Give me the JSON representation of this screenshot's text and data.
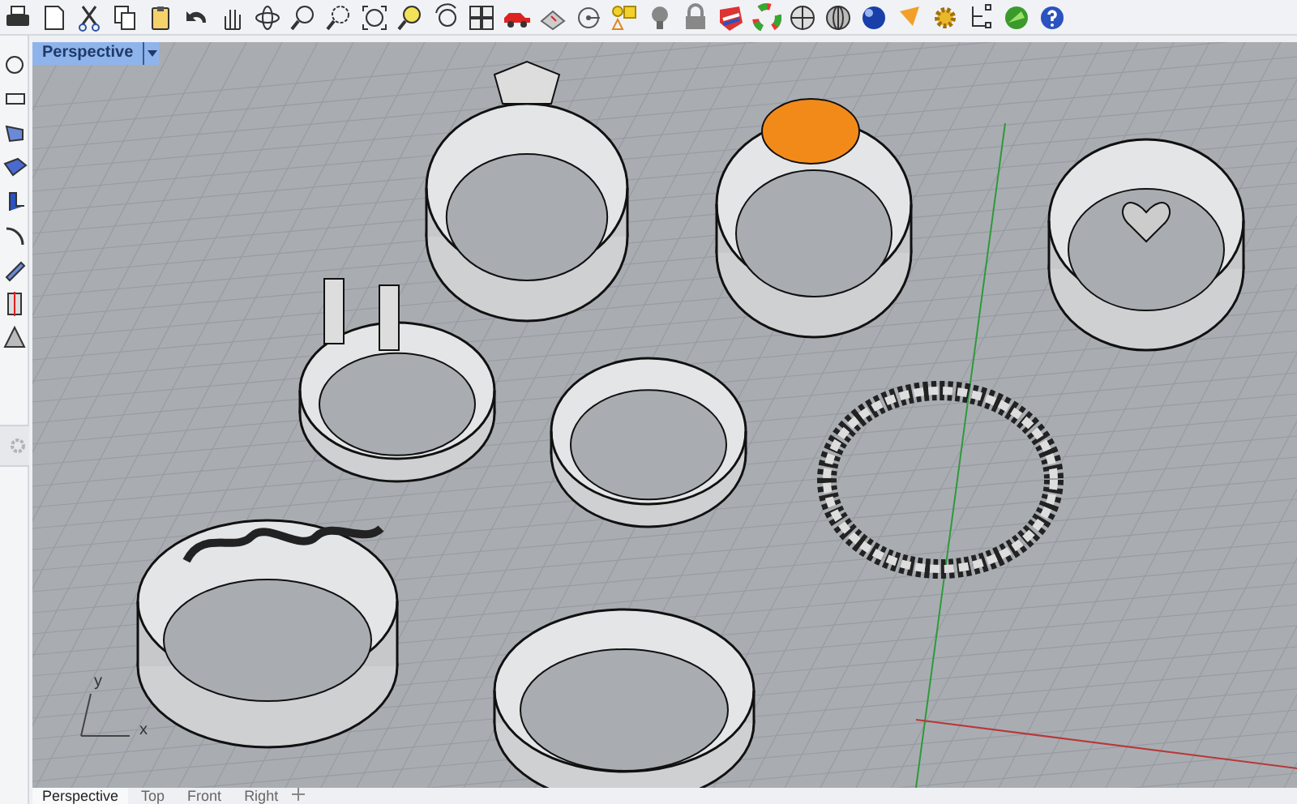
{
  "viewport": {
    "title": "Perspective",
    "axis_labels": [
      "x",
      "y"
    ]
  },
  "view_tabs": [
    {
      "label": "Perspective",
      "selected": true
    },
    {
      "label": "Top",
      "selected": false
    },
    {
      "label": "Front",
      "selected": false
    },
    {
      "label": "Right",
      "selected": false
    }
  ]
}
